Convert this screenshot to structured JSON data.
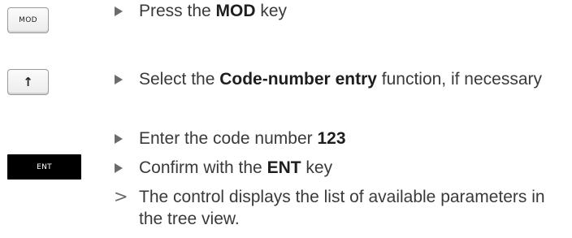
{
  "keys": {
    "mod": "MOD",
    "arrow_up": "arrow-up-icon",
    "ent": "ENT"
  },
  "steps": [
    {
      "marker": "triangle",
      "pre": "Press the ",
      "bold": "MOD",
      "post": " key"
    },
    {
      "marker": "triangle",
      "pre": "Select the ",
      "bold": "Code-number entry",
      "post": " function, if necessary"
    },
    {
      "marker": "triangle",
      "pre": "Enter the code number ",
      "bold": "123",
      "post": ""
    },
    {
      "marker": "triangle",
      "pre": "Confirm with the ",
      "bold": "ENT",
      "post": " key"
    },
    {
      "marker": "result",
      "symbol": ">",
      "text": "The control displays the list of available parameters in the tree view."
    }
  ]
}
